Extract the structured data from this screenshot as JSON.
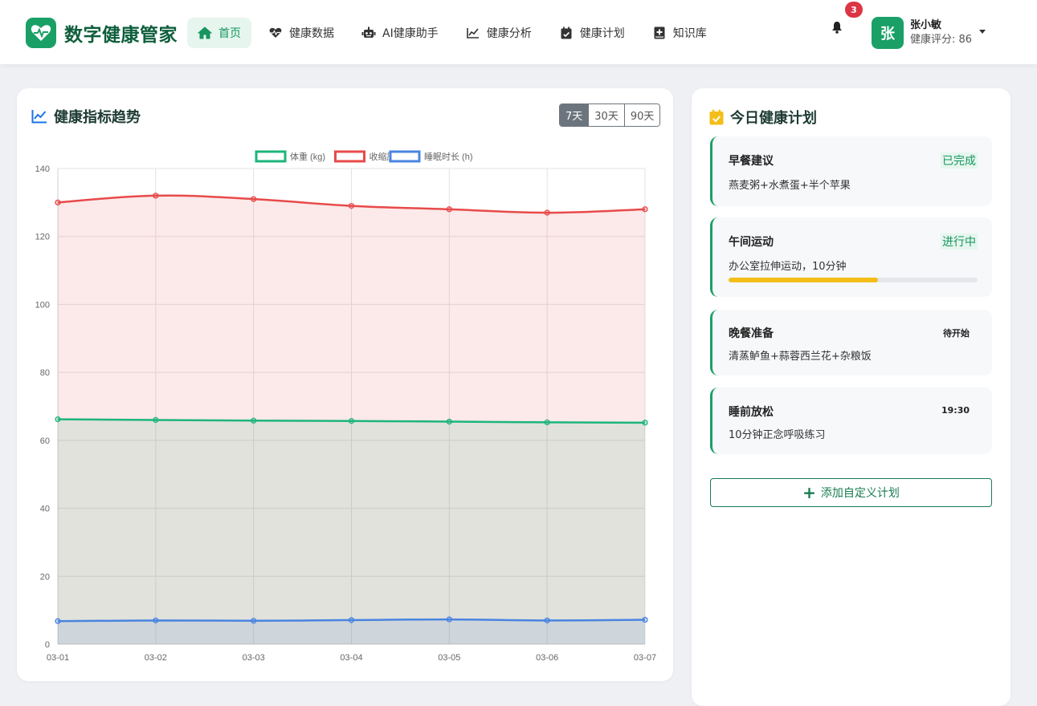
{
  "brand": {
    "name": "数字健康管家",
    "logo_icon": "heart-pulse-icon"
  },
  "nav": [
    {
      "label": "首页",
      "icon": "home-icon",
      "active": true
    },
    {
      "label": "健康数据",
      "icon": "heartbeat-icon"
    },
    {
      "label": "AI健康助手",
      "icon": "robot-icon"
    },
    {
      "label": "健康分析",
      "icon": "chart-line-icon"
    },
    {
      "label": "健康计划",
      "icon": "calendar-check-icon"
    },
    {
      "label": "知识库",
      "icon": "book-medical-icon"
    }
  ],
  "notifications": {
    "count": "3"
  },
  "user": {
    "avatar_char": "张",
    "name": "张小敏",
    "score": "健康评分: 86"
  },
  "trend": {
    "title": "健康指标趋势",
    "ranges": [
      "7天",
      "30天",
      "90天"
    ],
    "active_range": "7天"
  },
  "chart_data": {
    "type": "line",
    "categories": [
      "03-01",
      "03-02",
      "03-03",
      "03-04",
      "03-05",
      "03-06",
      "03-07"
    ],
    "ylim": [
      0,
      140
    ],
    "yticks": [
      0,
      20,
      40,
      60,
      80,
      100,
      120,
      140
    ],
    "grid": true,
    "legend_position": "top",
    "series": [
      {
        "name": "体重 (kg)",
        "color": "#1db57a",
        "values": [
          66.2,
          66.0,
          65.8,
          65.7,
          65.5,
          65.3,
          65.2
        ]
      },
      {
        "name": "收缩压",
        "color": "#e84a4a",
        "values": [
          130,
          132,
          131,
          129,
          128,
          127,
          128
        ]
      },
      {
        "name": "睡眠时长 (h)",
        "color": "#4a84e0",
        "values": [
          6.8,
          7.0,
          6.9,
          7.1,
          7.3,
          7.0,
          7.2
        ]
      }
    ]
  },
  "plan": {
    "title": "今日健康计划",
    "items": [
      {
        "name": "早餐建议",
        "desc": "燕麦粥+水煮蛋+半个苹果",
        "status": "已完成"
      },
      {
        "name": "午间运动",
        "desc": "办公室拉伸运动，10分钟",
        "status": "进行中",
        "progress": 0.6
      },
      {
        "name": "晚餐准备",
        "desc": "清蒸鲈鱼+蒜蓉西兰花+杂粮饭",
        "status": "待开始"
      },
      {
        "name": "睡前放松",
        "desc": "10分钟正念呼吸练习",
        "status": "19:30"
      }
    ],
    "add_label": "添加自定义计划"
  },
  "colors": {
    "brand": "#1aa067",
    "accent_yellow": "#f4be19",
    "danger": "#dc3545"
  }
}
